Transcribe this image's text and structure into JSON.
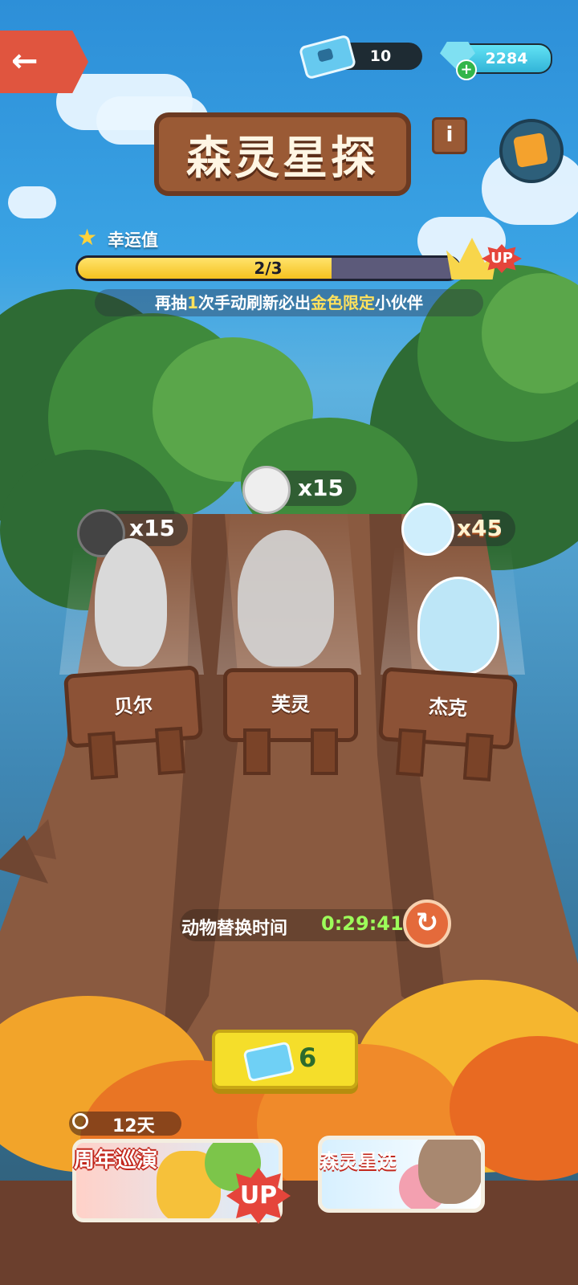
{
  "topbar": {
    "ticket_count": "10",
    "gem_count": "2284"
  },
  "title": "森灵星探",
  "info_label": "i",
  "luck": {
    "label": "幸运值",
    "progress_text": "2/3",
    "progress_fraction": 0.667,
    "up_badge": "UP",
    "hint_prefix": "再抽",
    "hint_count": "1",
    "hint_mid": "次手动刷新必出",
    "hint_highlight": "金色限定",
    "hint_suffix": "小伙伴"
  },
  "pedestals": [
    {
      "name": "贝尔",
      "count": "x15"
    },
    {
      "name": "芙灵",
      "count": "x15"
    },
    {
      "name": "杰克",
      "count": "x45"
    }
  ],
  "timer": {
    "label": "动物替换时间",
    "value": "0:29:41"
  },
  "draw_button": {
    "cost": "6"
  },
  "events": {
    "days_left": "12天",
    "event1_title": "周年巡演",
    "event1_badge": "UP",
    "event2_title": "森灵星选"
  },
  "colors": {
    "accent_yellow": "#f5de2a",
    "timer_green": "#9dfc5a",
    "highlight_yellow": "#ffe15c",
    "wood": "#8c5236",
    "back_red": "#e0553f"
  },
  "icons": [
    "back-arrow-icon",
    "ticket-icon",
    "gem-icon",
    "plus-icon",
    "info-icon",
    "gift-icon",
    "star-icon",
    "crown-icon",
    "refresh-icon",
    "clock-icon"
  ]
}
